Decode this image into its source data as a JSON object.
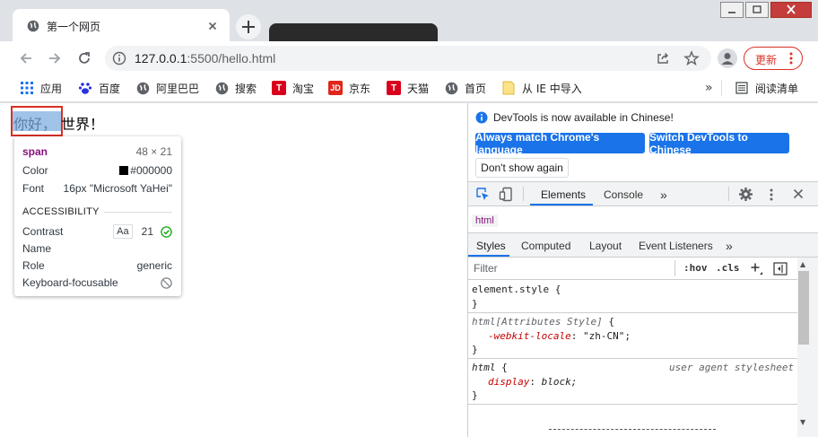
{
  "browser": {
    "tab_title": "第一个网页",
    "url_host": "127.0.0.1",
    "url_rest": ":5500/hello.html",
    "update_label": "更新"
  },
  "bookmarks": [
    {
      "label": "应用",
      "icon": "apps-grid-icon",
      "color": "#1a73e8"
    },
    {
      "label": "百度",
      "icon": "baidu-paw-icon",
      "color": "#2932e1"
    },
    {
      "label": "阿里巴巴",
      "icon": "globe-icon",
      "color": "#5f6368"
    },
    {
      "label": "搜索",
      "icon": "globe-icon",
      "color": "#5f6368"
    },
    {
      "label": "淘宝",
      "icon": "taobao-t-icon",
      "color": "#d9001b",
      "glyph": "T"
    },
    {
      "label": "京东",
      "icon": "jd-icon",
      "color": "#e1251b",
      "glyph": "JD"
    },
    {
      "label": "天猫",
      "icon": "tmall-t-icon",
      "color": "#d9001b",
      "glyph": "T"
    },
    {
      "label": "首页",
      "icon": "globe-icon",
      "color": "#5f6368"
    },
    {
      "label": "从 IE 中导入",
      "icon": "folder-icon",
      "color": "#f9d85a"
    }
  ],
  "reading_list": "阅读清单",
  "page": {
    "greeting_highlight": "你好，",
    "greeting_rest": "世界！"
  },
  "tooltip": {
    "tag": "span",
    "size": "48 × 21",
    "color_label": "Color",
    "color_value": "#000000",
    "font_label": "Font",
    "font_value": "16px \"Microsoft YaHei\"",
    "accessibility_heading": "ACCESSIBILITY",
    "contrast_label": "Contrast",
    "contrast_aa": "Aa",
    "contrast_value": "21",
    "name_label": "Name",
    "role_label": "Role",
    "role_value": "generic",
    "focusable_label": "Keyboard-focusable"
  },
  "devtools": {
    "info_text": "DevTools is now available in Chinese!",
    "btn_match": "Always match Chrome's language",
    "btn_switch": "Switch DevTools to Chinese",
    "btn_dont_show": "Don't show again",
    "tab_elements": "Elements",
    "tab_console": "Console",
    "breadcrumb": "html",
    "sub_tabs": [
      "Styles",
      "Computed",
      "Layout",
      "Event Listeners"
    ],
    "filter_placeholder": "Filter",
    "hov": ":hov",
    "cls": ".cls",
    "rules": {
      "r1_selector": "element.style",
      "r1_open": " {",
      "r1_close": "}",
      "r2_selector": "html[Attributes Style]",
      "r2_open": " {",
      "r2_prop": "-webkit-locale",
      "r2_value": "\"zh-CN\";",
      "r2_close": "}",
      "r3_selector": "html",
      "r3_open": " {",
      "r3_source": "user agent stylesheet",
      "r3_prop": "display",
      "r3_value": "block;",
      "r3_close": "}"
    }
  }
}
